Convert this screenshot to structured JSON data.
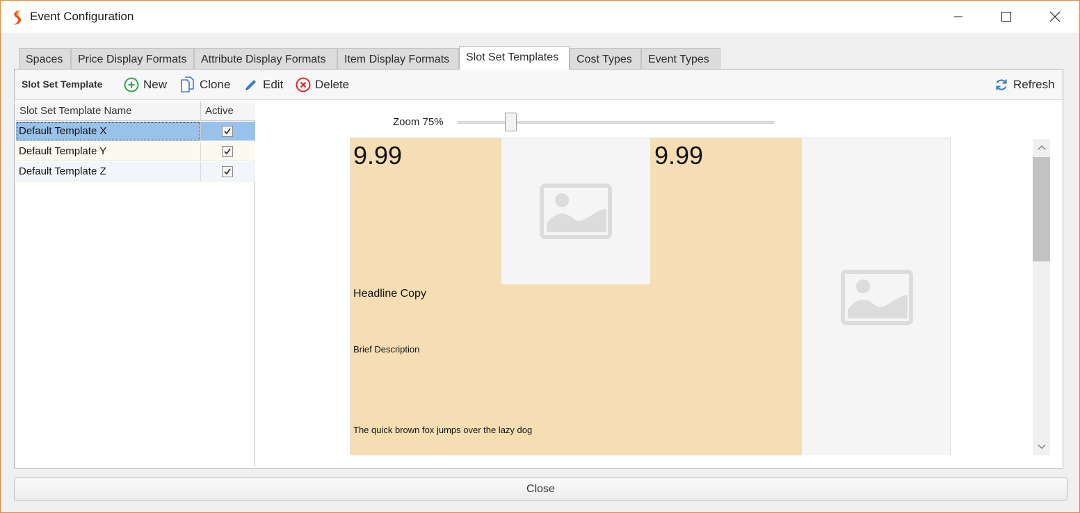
{
  "window": {
    "title": "Event Configuration"
  },
  "tabs": [
    {
      "label": "Spaces"
    },
    {
      "label": "Price Display Formats"
    },
    {
      "label": "Attribute Display Formats"
    },
    {
      "label": "Item Display Formats"
    },
    {
      "label": "Slot Set Templates",
      "active": true
    },
    {
      "label": "Cost Types"
    },
    {
      "label": "Event Types"
    }
  ],
  "toolbar": {
    "label": "Slot Set Template",
    "new_label": "New",
    "clone_label": "Clone",
    "edit_label": "Edit",
    "delete_label": "Delete",
    "refresh_label": "Refresh"
  },
  "grid": {
    "columns": [
      "Slot Set Template Name",
      "Active"
    ],
    "rows": [
      {
        "name": "Default Template X",
        "active": true,
        "selected": true
      },
      {
        "name": "Default Template Y",
        "active": true
      },
      {
        "name": "Default Template Z",
        "active": true
      }
    ]
  },
  "preview": {
    "zoom_label": "Zoom 75%",
    "zoom_value": 75,
    "price_1": "9.99",
    "price_2": "9.99",
    "headline": "Headline Copy",
    "brief": "Brief Description",
    "body": "The quick brown fox jumps over the lazy dog"
  },
  "footer": {
    "close_label": "Close"
  },
  "colors": {
    "window_border": "#e08a3c",
    "selected_row": "#99c2ea",
    "slot_fill": "#f5deb3",
    "placeholder": "#f5f5f5"
  }
}
